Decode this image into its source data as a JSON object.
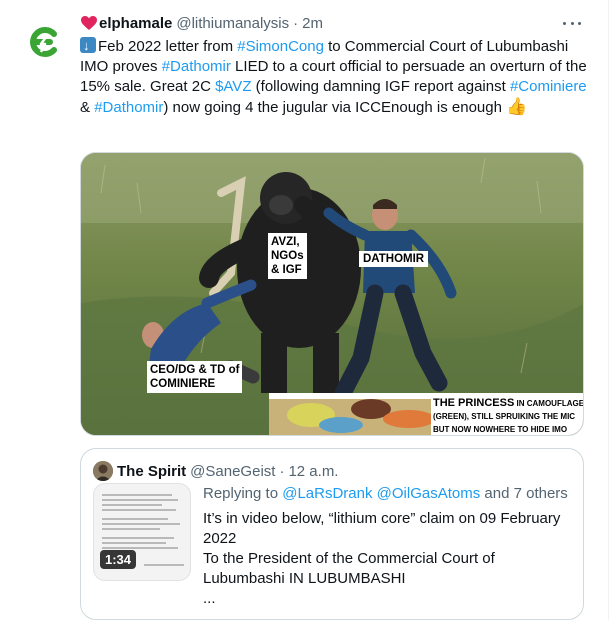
{
  "tweet": {
    "author_name": "elphamale",
    "author_handle": "@lithiumanalysis",
    "separator": "·",
    "time": "2m",
    "more_label": "More",
    "text": {
      "p1": "Feb 2022 letter from ",
      "m1": "#SimonCong",
      "p2": " to Commercial Court of Lubumbashi IMO proves ",
      "m2": "#Dathomir",
      "p3": " LIED to a court official to persuade an overturn of the 15% sale. Great 2C ",
      "m3": "$AVZ",
      "p4": " (following damning IGF report against ",
      "m4": "#Cominiere",
      "p5": " & ",
      "m5": "#Dathomir",
      "p6": ") now going 4 the jugular via ICCEnough is enough ",
      "thumb_emoji": "👍"
    },
    "media": {
      "labels": {
        "gorilla": [
          "AVZI,",
          "NGOs",
          "& IGF"
        ],
        "runner": "DATHOMIR",
        "fallen": [
          "CEO/DG & TD of",
          "COMINIERE"
        ],
        "princess_line1_big": "THE PRINCESS",
        "princess_line1_small": " IN CAMOUFLAGE",
        "princess_line2": "(GREEN), STILL SPRUIKING THE MIC",
        "princess_line3": "BUT NOW NOWHERE TO HIDE IMO"
      }
    }
  },
  "quote": {
    "author_name": "The Spirit",
    "author_handle": "@SaneGeist",
    "separator": "·",
    "time": "12 a.m.",
    "reply_prefix": "Replying to ",
    "reply_mentions": "@LaRsDrank @OilGasAtoms",
    "reply_suffix": " and 7 others",
    "video_duration": "1:34",
    "lines": [
      "It’s in video below, “lithium core” claim on 09 February 2022",
      "To the President of the Commercial Court of Lubumbashi IN LUBUMBASHI",
      "..."
    ]
  },
  "colors": {
    "link": "#1d9bf0",
    "secondary_text": "#536471",
    "border": "#cfd9de",
    "heart": "#e0245e",
    "logo_green": "#3aa535"
  },
  "icons": [
    "heart-icon",
    "more-icon",
    "down-arrow-emoji",
    "thumbs-up-emoji",
    "logo-icon"
  ]
}
